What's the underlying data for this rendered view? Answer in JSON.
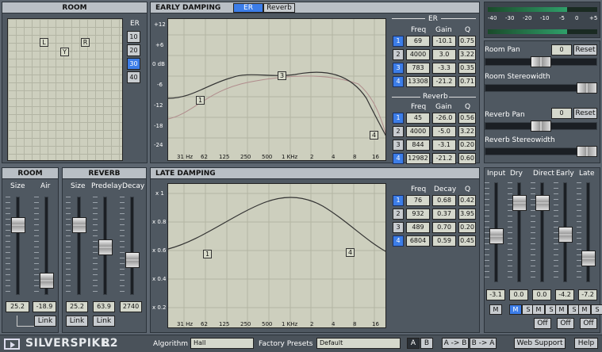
{
  "room_panel": {
    "title": "ROOM",
    "markers": [
      "L",
      "R",
      "Y"
    ],
    "er_label": "ER",
    "er_buttons": [
      "10",
      "20",
      "30",
      "40"
    ],
    "er_selected": 2
  },
  "early": {
    "title": "EARLY DAMPING",
    "tab_er": "ER",
    "tab_reverb": "Reverb",
    "y_ticks": [
      "+12",
      "+6",
      "0 dB",
      "-6",
      "-12",
      "-18",
      "-24"
    ],
    "x_ticks": [
      "31 Hz",
      "62",
      "125",
      "250",
      "500",
      "1 KHz",
      "2",
      "4",
      "8",
      "16"
    ],
    "er_section": "ER",
    "reverb_section": "Reverb",
    "cols": [
      "Freq",
      "Gain",
      "Q"
    ],
    "er_rows": [
      {
        "n": "1",
        "freq": "69",
        "gain": "-10.1",
        "q": "0.75",
        "on": true
      },
      {
        "n": "2",
        "freq": "4000",
        "gain": "3.0",
        "q": "3.22",
        "on": false
      },
      {
        "n": "3",
        "freq": "783",
        "gain": "-3.3",
        "q": "0.35",
        "on": true
      },
      {
        "n": "4",
        "freq": "13308",
        "gain": "-21.2",
        "q": "0.71",
        "on": true
      }
    ],
    "rev_rows": [
      {
        "n": "1",
        "freq": "45",
        "gain": "-26.0",
        "q": "0.56",
        "on": true
      },
      {
        "n": "2",
        "freq": "4000",
        "gain": "-5.0",
        "q": "3.22",
        "on": false
      },
      {
        "n": "3",
        "freq": "844",
        "gain": "-3.1",
        "q": "0.20",
        "on": false
      },
      {
        "n": "4",
        "freq": "12982",
        "gain": "-21.2",
        "q": "0.60",
        "on": true
      }
    ],
    "band_markers": [
      "1",
      "3",
      "4"
    ]
  },
  "late": {
    "title": "LATE DAMPING",
    "y_ticks": [
      "x 1",
      "x 0.8",
      "x 0.6",
      "x 0.4",
      "x 0.2"
    ],
    "x_ticks": [
      "31 Hz",
      "62",
      "125",
      "250",
      "500",
      "1 KHz",
      "2",
      "4",
      "8",
      "16"
    ],
    "cols": [
      "Freq",
      "Decay",
      "Q"
    ],
    "rows": [
      {
        "n": "1",
        "freq": "76",
        "decay": "0.68",
        "q": "0.42",
        "on": true
      },
      {
        "n": "2",
        "freq": "932",
        "decay": "0.37",
        "q": "3.95",
        "on": false
      },
      {
        "n": "3",
        "freq": "489",
        "decay": "0.70",
        "q": "0.20",
        "on": false
      },
      {
        "n": "4",
        "freq": "6804",
        "decay": "0.59",
        "q": "0.45",
        "on": true
      }
    ],
    "band_markers": [
      "1",
      "4"
    ]
  },
  "room_size": {
    "title": "ROOM",
    "size_label": "Size",
    "air_label": "Air",
    "size_val": "25.2",
    "air_val": "-18.9",
    "link": "Link"
  },
  "reverb": {
    "title": "REVERB",
    "size_label": "Size",
    "predelay_label": "Predelay",
    "decay_label": "Decay",
    "size_val": "25.2",
    "predelay_val": "63.9",
    "decay_val": "2740",
    "link1": "Link",
    "link2": "Link"
  },
  "meter": {
    "ticks": [
      "-40",
      "-30",
      "-20",
      "-10",
      "-5",
      "0",
      "+5"
    ]
  },
  "pan": {
    "room_pan": "Room Pan",
    "room_pan_val": "0",
    "reset": "Reset",
    "room_width": "Room Stereowidth",
    "reverb_pan": "Reverb Pan",
    "reverb_pan_val": "0",
    "reverb_width": "Reverb Stereowidth"
  },
  "mixer": {
    "labels": [
      "Input",
      "Dry",
      "Direct",
      "Early",
      "Late"
    ],
    "values": [
      "-3.1",
      "0.0",
      "0.0",
      "-4.2",
      "-7.2"
    ],
    "m": "M",
    "s": "S",
    "off": "Off"
  },
  "bottom": {
    "brand": "SILVERSPIKE",
    "model": "R2",
    "algorithm_label": "Algorithm",
    "algorithm": "Hall",
    "presets_label": "Factory Presets",
    "preset": "Default",
    "a": "A",
    "b": "B",
    "atob": "A -> B",
    "btoa": "B -> A",
    "web": "Web Support",
    "help": "Help"
  }
}
